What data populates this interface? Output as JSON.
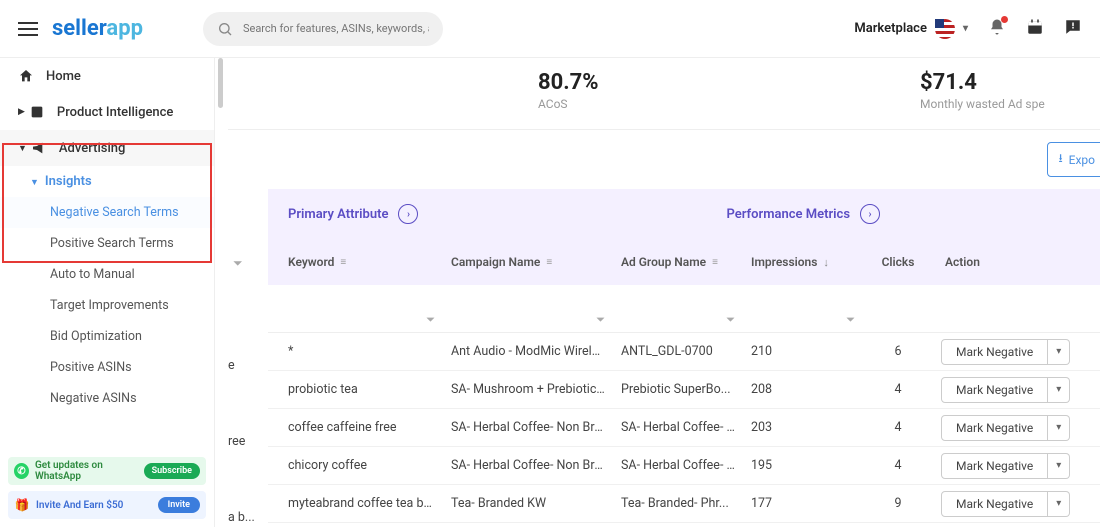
{
  "topbar": {
    "search_placeholder": "Search for features, ASINs, keywords, and more",
    "marketplace_label": "Marketplace"
  },
  "logo": {
    "part1": "seller",
    "part2": "app"
  },
  "sidebar": {
    "home": "Home",
    "product_intel": "Product Intelligence",
    "advertising": "Advertising",
    "insights": "Insights",
    "items": {
      "neg_search": "Negative Search Terms",
      "pos_search": "Positive Search Terms",
      "auto_manual": "Auto to Manual",
      "target_imp": "Target Improvements",
      "bid_opt": "Bid Optimization",
      "pos_asins": "Positive ASINs",
      "neg_asins": "Negative ASINs"
    },
    "whatsapp": "Get updates on WhatsApp",
    "subscribe": "Subscribe",
    "invite_text": "Invite And Earn $50",
    "invite_btn": "Invite"
  },
  "kpi": {
    "acos_val": "80.7%",
    "acos_lab": "ACoS",
    "spend_val": "$71.4",
    "spend_lab": "Monthly wasted Ad spe"
  },
  "export_label": "Expo",
  "table": {
    "primary_attr": "Primary Attribute",
    "perf_metrics": "Performance Metrics",
    "cols": {
      "keyword": "Keyword",
      "campaign": "Campaign Name",
      "adgroup": "Ad Group Name",
      "impressions": "Impressions",
      "clicks": "Clicks",
      "action": "Action"
    },
    "action_label": "Mark Negative",
    "rows": [
      {
        "kw": "*",
        "camp": "Ant Audio - ModMic Wirele...",
        "ag": "ANTL_GDL-0700",
        "imp": "210",
        "clk": "6"
      },
      {
        "kw": "probiotic tea",
        "camp": "SA- Mushroom + Prebiotic ...",
        "ag": "Prebiotic SuperBo...",
        "imp": "208",
        "clk": "4"
      },
      {
        "kw": "coffee caffeine free",
        "camp": "SA- Herbal Coffee- Non Bra...",
        "ag": "SA- Herbal Coffee- ...",
        "imp": "203",
        "clk": "4"
      },
      {
        "kw": "chicory coffee",
        "camp": "SA- Herbal Coffee- Non Bra...",
        "ag": "SA- Herbal Coffee- ...",
        "imp": "195",
        "clk": "4"
      },
      {
        "kw": "myteabrand coffee tea bags",
        "camp": "Tea- Branded KW",
        "ag": "Tea- Branded- Phr...",
        "imp": "177",
        "clk": "9"
      }
    ]
  },
  "cut": {
    "r1": "e",
    "r2": "ree",
    "r3": "a b..."
  }
}
